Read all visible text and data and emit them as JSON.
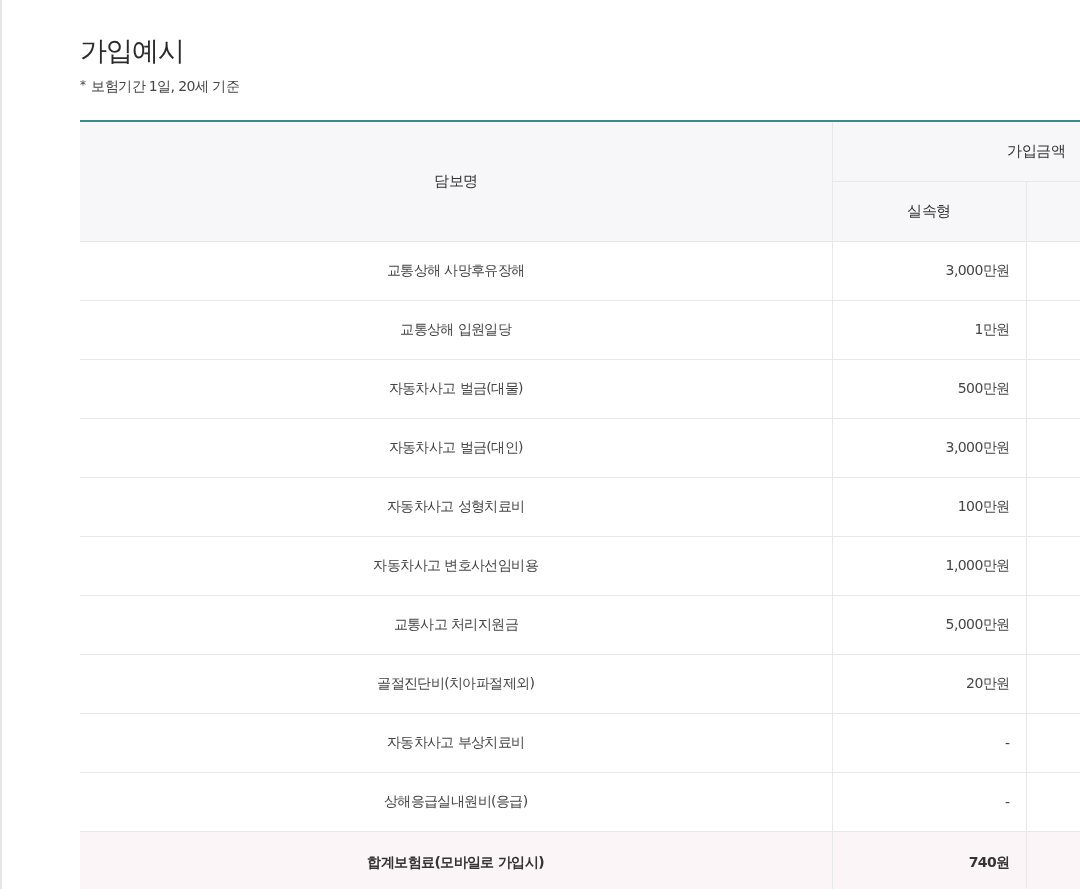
{
  "title": "가입예시",
  "note_mark": "*",
  "note": "보험기간 1일, 20세 기준",
  "table": {
    "columns": {
      "name": "담보명",
      "group": "가입금액",
      "sub": "실속형"
    },
    "rows": [
      {
        "name": "교통상해 사망후유장해",
        "amount": "3,000만원"
      },
      {
        "name": "교통상해 입원일당",
        "amount": "1만원"
      },
      {
        "name": "자동차사고 벌금(대물)",
        "amount": "500만원"
      },
      {
        "name": "자동차사고 벌금(대인)",
        "amount": "3,000만원"
      },
      {
        "name": "자동차사고 성형치료비",
        "amount": "100만원"
      },
      {
        "name": "자동차사고 변호사선임비용",
        "amount": "1,000만원"
      },
      {
        "name": "교통사고 처리지원금",
        "amount": "5,000만원"
      },
      {
        "name": "골절진단비(치아파절제외)",
        "amount": "20만원"
      },
      {
        "name": "자동차사고 부상치료비",
        "amount": "-"
      },
      {
        "name": "상해응급실내원비(응급)",
        "amount": "-"
      }
    ],
    "total": {
      "name": "합계보험료(모바일로 가입시)",
      "amount": "740원"
    }
  }
}
